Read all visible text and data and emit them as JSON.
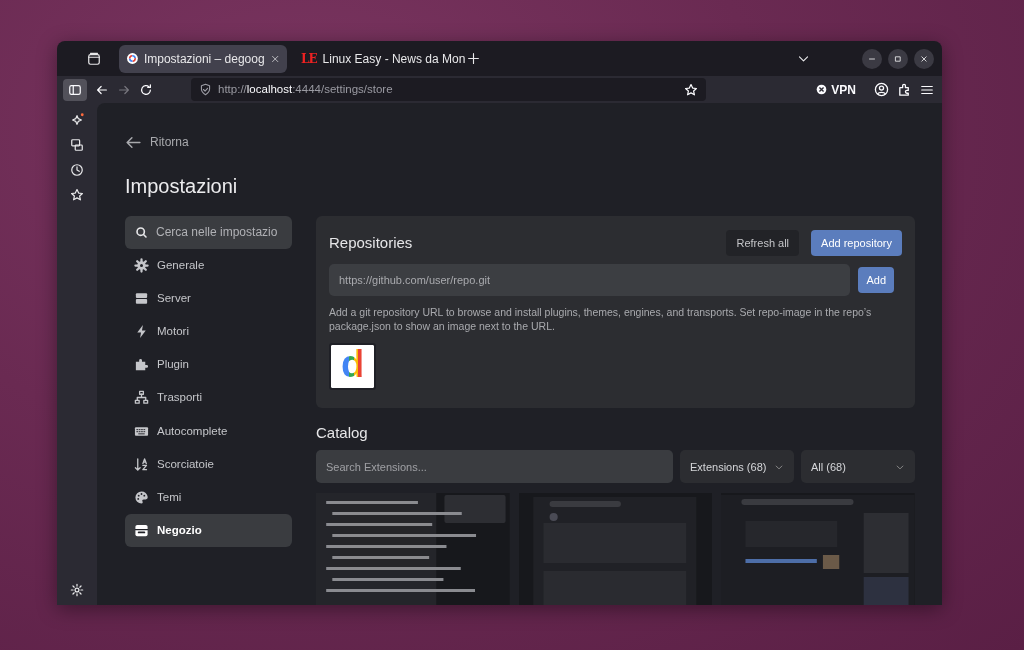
{
  "browser": {
    "tabs": [
      {
        "title": "Impostazioni – degoog",
        "selected": true
      },
      {
        "title": "Linux Easy - News da Mon",
        "selected": false,
        "favicon_text": "LE"
      }
    ],
    "address": {
      "scheme": "http://",
      "host": "localhost",
      "path": ":4444/settings/store"
    },
    "vpn": "VPN"
  },
  "page": {
    "back": "Ritorna",
    "title": "Impostazioni",
    "search": {
      "placeholder": "Cerca nelle impostazio"
    },
    "nav": [
      {
        "label": "Generale",
        "selected": false
      },
      {
        "label": "Server",
        "selected": false
      },
      {
        "label": "Motori",
        "selected": false
      },
      {
        "label": "Plugin",
        "selected": false
      },
      {
        "label": "Trasporti",
        "selected": false
      },
      {
        "label": "Autocomplete",
        "selected": false
      },
      {
        "label": "Scorciatoie",
        "selected": false
      },
      {
        "label": "Temi",
        "selected": false
      },
      {
        "label": "Negozio",
        "selected": true
      }
    ],
    "repositories": {
      "title": "Repositories",
      "refresh": "Refresh all",
      "add_repository": "Add repository",
      "url_field": {
        "placeholder": "https://github.com/user/repo.git"
      },
      "add": "Add",
      "help": "Add a git repository URL to browse and install plugins, themes, engines, and transports. Set repo-image in the repo’s package.json to show an image next to the URL.",
      "repo_logo": "d"
    },
    "catalog": {
      "title": "Catalog",
      "search": {
        "placeholder": "Search Extensions..."
      },
      "filters": [
        "Extensions (68)",
        "All (68)"
      ],
      "items": [
        {
          "kind": "picture"
        },
        {
          "kind": "picture"
        },
        {
          "kind": "picture"
        }
      ]
    }
  }
}
